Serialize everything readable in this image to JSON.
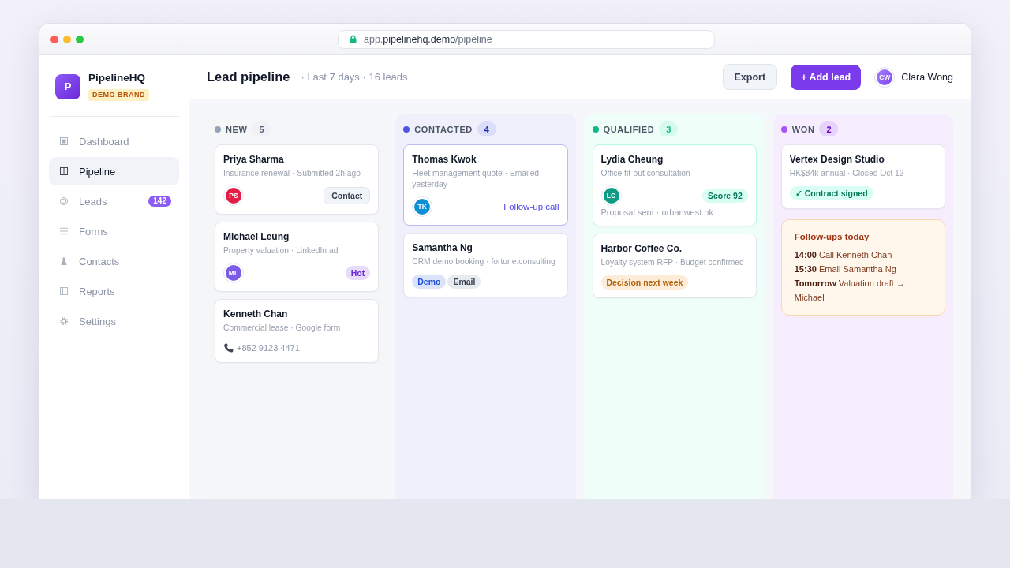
{
  "browser": {
    "url": "app.**pipelinehq.demo**/pipeline"
  },
  "sidebar": {
    "brand": {
      "logo": "P",
      "name": "PipelineHQ",
      "badge": "DEMO BRAND"
    },
    "nav": [
      {
        "label": "Dashboard",
        "selected": false
      },
      {
        "label": "Pipeline",
        "selected": true
      },
      {
        "label": "Leads",
        "selected": false,
        "badge": "142"
      },
      {
        "label": "Forms",
        "selected": false
      },
      {
        "label": "Contacts",
        "selected": false
      },
      {
        "label": "Reports",
        "selected": false
      },
      {
        "label": "Settings",
        "selected": false
      }
    ]
  },
  "header": {
    "title": "Lead pipeline",
    "subtitle": "· Last 7 days · 16 leads",
    "buttons": [
      {
        "label": "Export",
        "kind": "secondary"
      },
      {
        "label": "+ Add lead",
        "kind": "primary"
      }
    ],
    "user": {
      "initials": "CW",
      "name": "Clara Wong"
    }
  },
  "columns": [
    {
      "label": "NEW",
      "count": "5",
      "color": "#94a3b8",
      "cards": [
        {
          "kind": "lead",
          "name": "Priya Sharma",
          "details": "Insurance renewal · Submitted 2h ago",
          "highlighted": false,
          "avatar": {
            "initials": "PS",
            "color": "#e11d48"
          },
          "action": {
            "kind": "button",
            "label": "Contact"
          }
        },
        {
          "kind": "lead",
          "name": "Michael Leung",
          "details": "Property valuation · LinkedIn ad",
          "highlighted": false,
          "avatar": {
            "initials": "ML",
            "color": "#7c5ce6"
          },
          "tags": [
            {
              "label": "Hot",
              "color": "#6d28d9"
            }
          ]
        },
        {
          "kind": "lead",
          "name": "Kenneth Chan",
          "details": "Commercial lease · Google form",
          "highlighted": false,
          "phone": "+852 9123 4471"
        }
      ]
    },
    {
      "label": "CONTACTED",
      "count": "4",
      "color": "#4f55e0",
      "cards": [
        {
          "kind": "lead",
          "name": "Thomas Kwok",
          "details": "Fleet management quote · Emailed yesterday",
          "highlighted": true,
          "avatar": {
            "initials": "TK",
            "color": "#0b8fd6"
          },
          "action": {
            "kind": "link",
            "label": "Follow-up call"
          }
        },
        {
          "kind": "lead",
          "name": "Samantha Ng",
          "details": "CRM demo booking · fortune.consulting",
          "highlighted": false,
          "tags": [
            {
              "label": "Demo",
              "color": "#1d4ed8"
            },
            {
              "label": "Email",
              "color": "#374151"
            }
          ]
        }
      ]
    },
    {
      "label": "QUALIFIED",
      "count": "3",
      "color": "#10b981",
      "cards": [
        {
          "kind": "lead",
          "name": "Lydia Cheung",
          "details": "Office fit-out consultation",
          "highlighted": true,
          "avatar": {
            "initials": "LC",
            "color": "#0f9b86"
          },
          "tags": [
            {
              "label": "Score 92",
              "color": "#047857"
            }
          ],
          "note": "Proposal sent · urbanwest.hk"
        },
        {
          "kind": "lead",
          "name": "Harbor Coffee Co.",
          "details": "Loyalty system RFP · Budget confirmed",
          "highlighted": false,
          "tags": [
            {
              "label": "Decision next week",
              "color": "#b0620a"
            }
          ]
        }
      ]
    },
    {
      "label": "WON",
      "count": "2",
      "color": "#a855f7",
      "cards": [
        {
          "kind": "lead",
          "name": "Vertex Design Studio",
          "details": "HK$84k annual · Closed Oct 12",
          "highlighted": false,
          "tags": [
            {
              "label": "✓ Contract signed",
              "color": "#047857"
            }
          ]
        },
        {
          "kind": "note",
          "title": "Follow-ups today",
          "lines": [
            "**14:00** Call Kenneth Chan",
            "**15:30** Email Samantha Ng",
            "**Tomorrow** Valuation draft → Michael"
          ]
        }
      ]
    }
  ]
}
